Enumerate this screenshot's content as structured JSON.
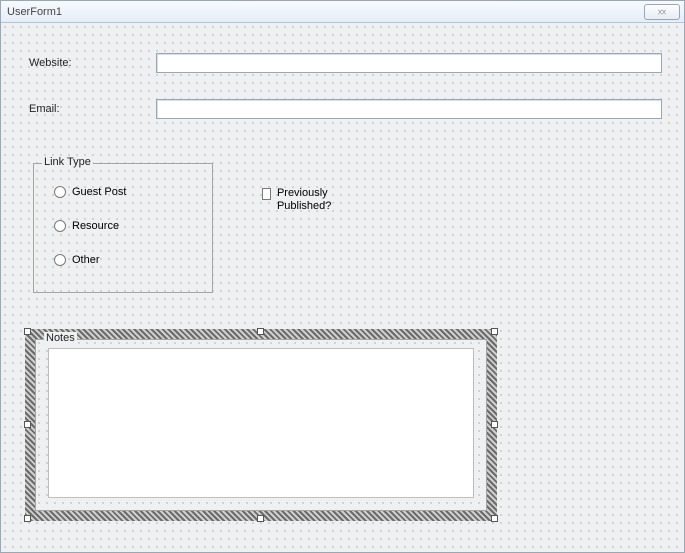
{
  "window": {
    "title": "UserForm1"
  },
  "fields": {
    "website_label": "Website:",
    "website_value": "",
    "email_label": "Email:",
    "email_value": ""
  },
  "link_type": {
    "legend": "Link Type",
    "options": {
      "guest_post": "Guest Post",
      "resource": "Resource",
      "other": "Other"
    }
  },
  "checkbox": {
    "previously_published_label": "Previously Published?",
    "previously_published_checked": false
  },
  "notes": {
    "legend": "Notes",
    "value": ""
  }
}
